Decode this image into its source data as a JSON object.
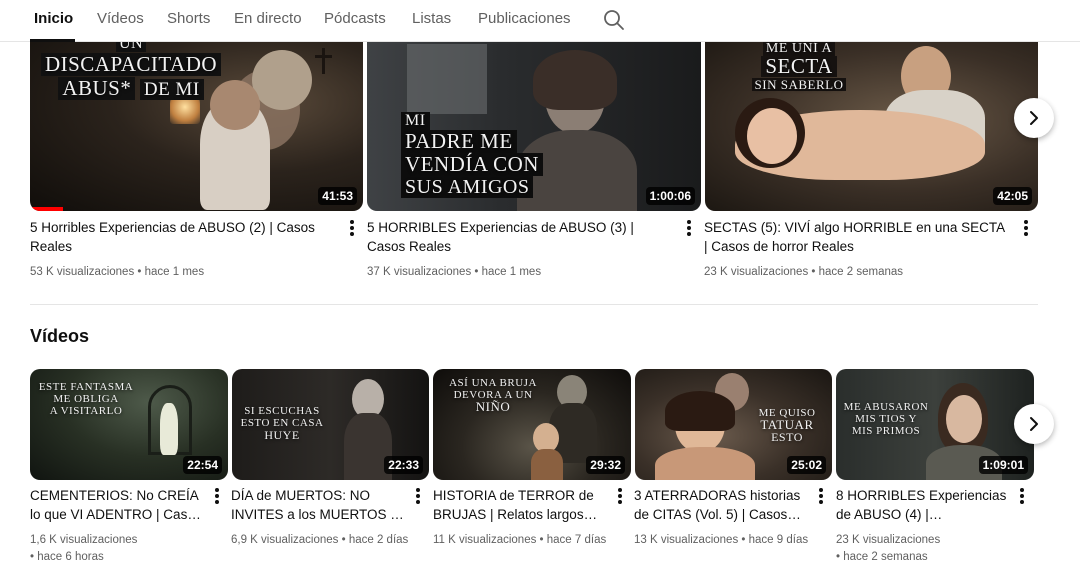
{
  "tabs": [
    {
      "label": "Inicio",
      "active": true
    },
    {
      "label": "Vídeos"
    },
    {
      "label": "Shorts"
    },
    {
      "label": "En directo"
    },
    {
      "label": "Pódcasts"
    },
    {
      "label": "Listas"
    },
    {
      "label": "Publicaciones"
    }
  ],
  "top_row": [
    {
      "thumb_text": [
        "UN",
        "DISCAPACITADO",
        "ABUS*",
        "DE MI"
      ],
      "duration": "41:53",
      "watched_fraction": 0.1,
      "title": "5 Horribles Experiencias de ABUSO (2) | Casos Reales",
      "views": "53 K visualizaciones",
      "age": "hace 1 mes"
    },
    {
      "thumb_text": [
        "MI",
        "PADRE ME",
        "VENDÍA CON",
        "SUS AMIGOS"
      ],
      "duration": "1:00:06",
      "title": "5 HORRIBLES Experiencias de ABUSO (3) | Casos Reales",
      "views": "37 K visualizaciones",
      "age": "hace 1 mes"
    },
    {
      "thumb_text": [
        "ME UNÍ A",
        "SECTA",
        "SIN SABERLO"
      ],
      "duration": "42:05",
      "title": "SECTAS (5): VIVÍ algo HORRIBLE en una SECTA | Casos de horror Reales",
      "views": "23 K visualizaciones",
      "age": "hace 2 semanas"
    }
  ],
  "section_title": "Vídeos",
  "bottom_row": [
    {
      "thumb_text": [
        "ESTE FANTASMA",
        "ME OBLIGA",
        "A VISITARLO"
      ],
      "duration": "22:54",
      "title": "CEMENTERIOS: No CREÍA lo que VI ADENTRO | Casos de…",
      "views": "1,6 K visualizaciones",
      "age": "hace 6 horas"
    },
    {
      "thumb_text": [
        "SI ESCUCHAS",
        "ESTO EN CASA",
        "HUYE"
      ],
      "duration": "22:33",
      "title": "DÍA de MUERTOS: NO INVITES a los MUERTOS a t…",
      "views": "6,9 K visualizaciones",
      "age": "hace 2 días"
    },
    {
      "thumb_text": [
        "ASÍ UNA BRUJA",
        "DEVORA A UN",
        "NIÑO"
      ],
      "duration": "29:32",
      "title": "HISTORIA de TERROR de BRUJAS | Relatos largos de…",
      "views": "11 K visualizaciones",
      "age": "hace 7 días"
    },
    {
      "thumb_text": [
        "ME QUISO",
        "TATUAR",
        "ESTO"
      ],
      "duration": "25:02",
      "title": "3 ATERRADORAS historias de CITAS (Vol. 5) | Casos de…",
      "views": "13 K visualizaciones",
      "age": "hace 9 días"
    },
    {
      "thumb_text": [
        "ME ABUSARON",
        "MIS TIOS Y",
        "MIS PRIMOS"
      ],
      "duration": "1:09:01",
      "title": "8 HORRIBLES Experiencias de ABUSO (4) | Compilación…",
      "views": "23 K visualizaciones",
      "age": "hace 2 semanas"
    }
  ],
  "icons": {
    "search": "search-icon",
    "next": "chevron-right-icon",
    "menu": "more-vert-icon"
  },
  "colors": {
    "progress": "#ff0000",
    "text_primary": "#0f0f0f",
    "text_secondary": "#606060"
  }
}
